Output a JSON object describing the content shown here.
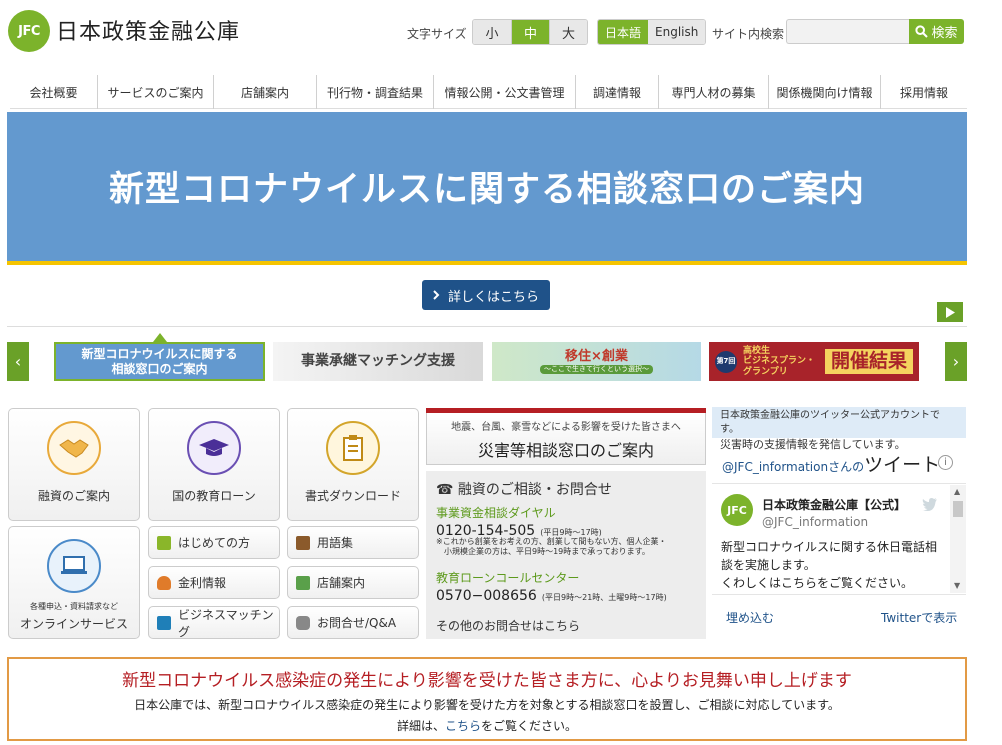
{
  "header": {
    "logo_mark": "JFC",
    "logo_text": "日本政策金融公庫",
    "font_size_label": "文字サイズ",
    "font_sizes": [
      "小",
      "中",
      "大"
    ],
    "font_size_active": "中",
    "languages": [
      "日本語",
      "English"
    ],
    "language_active": "日本語",
    "site_search_label": "サイト内検索",
    "search_value": "",
    "search_button": "検索"
  },
  "global_nav": [
    "会社概要",
    "サービスのご案内",
    "店舗案内",
    "刊行物・調査結果",
    "情報公開・公文書管理",
    "調達情報",
    "専門人材の募集",
    "関係機関向け情報",
    "採用情報"
  ],
  "hero": {
    "title": "新型コロナウイルスに関する相談窓口のご案内",
    "detail_button": "詳しくはこちら"
  },
  "carousel": {
    "slide1": [
      "新型コロナウイルスに関する",
      "相談窓口のご案内"
    ],
    "slide2": "事業承継マッチング支援",
    "slide3": "移住×創業",
    "slide3_sub": "〜ここで生きて行くという選択〜",
    "slide4_badge": "第7回",
    "slide4_left": [
      "高校生",
      "ビジネスプラン・",
      "グランプリ"
    ],
    "slide4_right": "開催結果"
  },
  "tiles_big": [
    {
      "label": "融資のご案内",
      "icon": "handshake-icon"
    },
    {
      "label": "国の教育ローン",
      "icon": "graduation-cap-icon"
    },
    {
      "label": "書式ダウンロード",
      "icon": "document-icon"
    }
  ],
  "online": {
    "sub": "各種申込・資料請求など",
    "label": "オンラインサービス",
    "icon": "laptop-icon"
  },
  "tiles_small": [
    {
      "label": "はじめての方",
      "color": "#8ab62a"
    },
    {
      "label": "用語集",
      "color": "#8b5a2b"
    },
    {
      "label": "金利情報",
      "color": "#e07b2a"
    },
    {
      "label": "店舗案内",
      "color": "#5aa04a"
    },
    {
      "label": "ビジネスマッチング",
      "color": "#1f7fb8"
    },
    {
      "label": "お問合せ/Q&A",
      "color": "#888888"
    }
  ],
  "disaster": {
    "sub": "地震、台風、豪雪などによる影響を受けた皆さまへ",
    "title": "災害等相談窓口のご案内"
  },
  "contact": {
    "heading": "融資のご相談・お問合せ",
    "dial1_title": "事業資金相談ダイヤル",
    "dial1_number": "0120-154-505",
    "dial1_hours": "(平日9時〜17時)",
    "dial1_note1": "※これから創業をお考えの方、創業して間もない方、個人企業・",
    "dial1_note2": "小規模企業の方は、平日9時〜19時まで承っております。",
    "dial2_title": "教育ローンコールセンター",
    "dial2_number": "0570−008656",
    "dial2_hours": "(平日9時〜21時、土曜9時〜17時)",
    "other": "その他のお問合せはこちら"
  },
  "twitter": {
    "intro1": "日本政策金融公庫のツイッター公式アカウントです。",
    "intro2": "災害時の支援情報を発信しています。",
    "handle_link": "@JFC_informationさんの",
    "tweet_word": "ツイート",
    "account_name": "日本政策金融公庫【公式】",
    "account_handle": "@JFC_information",
    "tweet_line1": "新型コロナウイルスに関する休日電話相",
    "tweet_line2": "談を実施します。",
    "tweet_line3": "くわしくはこちらをご覧ください。",
    "embed": "埋め込む",
    "view_on_twitter": "Twitterで表示"
  },
  "notice": {
    "headline": "新型コロナウイルス感染症の発生により影響を受けた皆さま方に、心よりお見舞い申し上げます",
    "body": "日本公庫では、新型コロナウイルス感染症の発生により影響を受けた方を対象とする相談窓口を設置し、ご相談に対応しています。",
    "detail_prefix": "詳細は、",
    "detail_link": "こちら",
    "detail_suffix": "をご覧ください。"
  },
  "colors": {
    "brand_green": "#7cb32b",
    "hero_blue": "#6399cf",
    "navy": "#1f5289",
    "accent_red": "#b51e23"
  }
}
